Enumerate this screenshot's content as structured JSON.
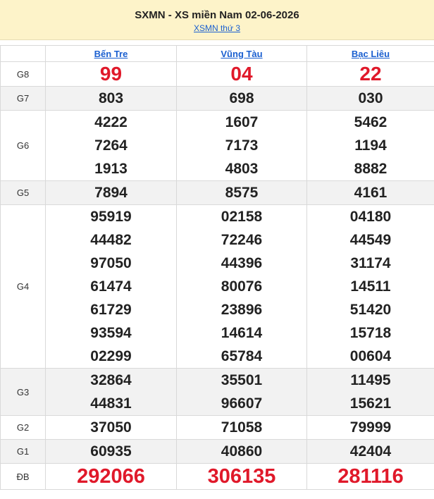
{
  "header": {
    "title": "SXMN - XS miền Nam 02-06-2026",
    "subtitle_link": "XSMN thứ 3"
  },
  "provinces": [
    "Bến Tre",
    "Vũng Tàu",
    "Bạc Liêu"
  ],
  "prizes": [
    {
      "label": "G8",
      "style": "g8",
      "values": [
        [
          "99"
        ],
        [
          "04"
        ],
        [
          "22"
        ]
      ]
    },
    {
      "label": "G7",
      "style": "normal",
      "values": [
        [
          "803"
        ],
        [
          "698"
        ],
        [
          "030"
        ]
      ]
    },
    {
      "label": "G6",
      "style": "normal",
      "values": [
        [
          "4222",
          "7264",
          "1913"
        ],
        [
          "1607",
          "7173",
          "4803"
        ],
        [
          "5462",
          "1194",
          "8882"
        ]
      ]
    },
    {
      "label": "G5",
      "style": "normal",
      "values": [
        [
          "7894"
        ],
        [
          "8575"
        ],
        [
          "4161"
        ]
      ]
    },
    {
      "label": "G4",
      "style": "normal",
      "values": [
        [
          "95919",
          "44482",
          "97050",
          "61474",
          "61729",
          "93594",
          "02299"
        ],
        [
          "02158",
          "72246",
          "44396",
          "80076",
          "23896",
          "14614",
          "65784"
        ],
        [
          "04180",
          "44549",
          "31174",
          "14511",
          "51420",
          "15718",
          "00604"
        ]
      ]
    },
    {
      "label": "G3",
      "style": "normal",
      "values": [
        [
          "32864",
          "44831"
        ],
        [
          "35501",
          "96607"
        ],
        [
          "11495",
          "15621"
        ]
      ]
    },
    {
      "label": "G2",
      "style": "normal",
      "values": [
        [
          "37050"
        ],
        [
          "71058"
        ],
        [
          "79999"
        ]
      ]
    },
    {
      "label": "G1",
      "style": "normal",
      "values": [
        [
          "60935"
        ],
        [
          "40860"
        ],
        [
          "42404"
        ]
      ]
    },
    {
      "label": "ĐB",
      "style": "special",
      "values": [
        [
          "292066"
        ],
        [
          "306135"
        ],
        [
          "281116"
        ]
      ]
    }
  ],
  "colors": {
    "header_bg": "#fdf3c9",
    "link": "#1a5fd0",
    "highlight_red": "#e0192a",
    "shaded_row": "#f2f2f2"
  }
}
